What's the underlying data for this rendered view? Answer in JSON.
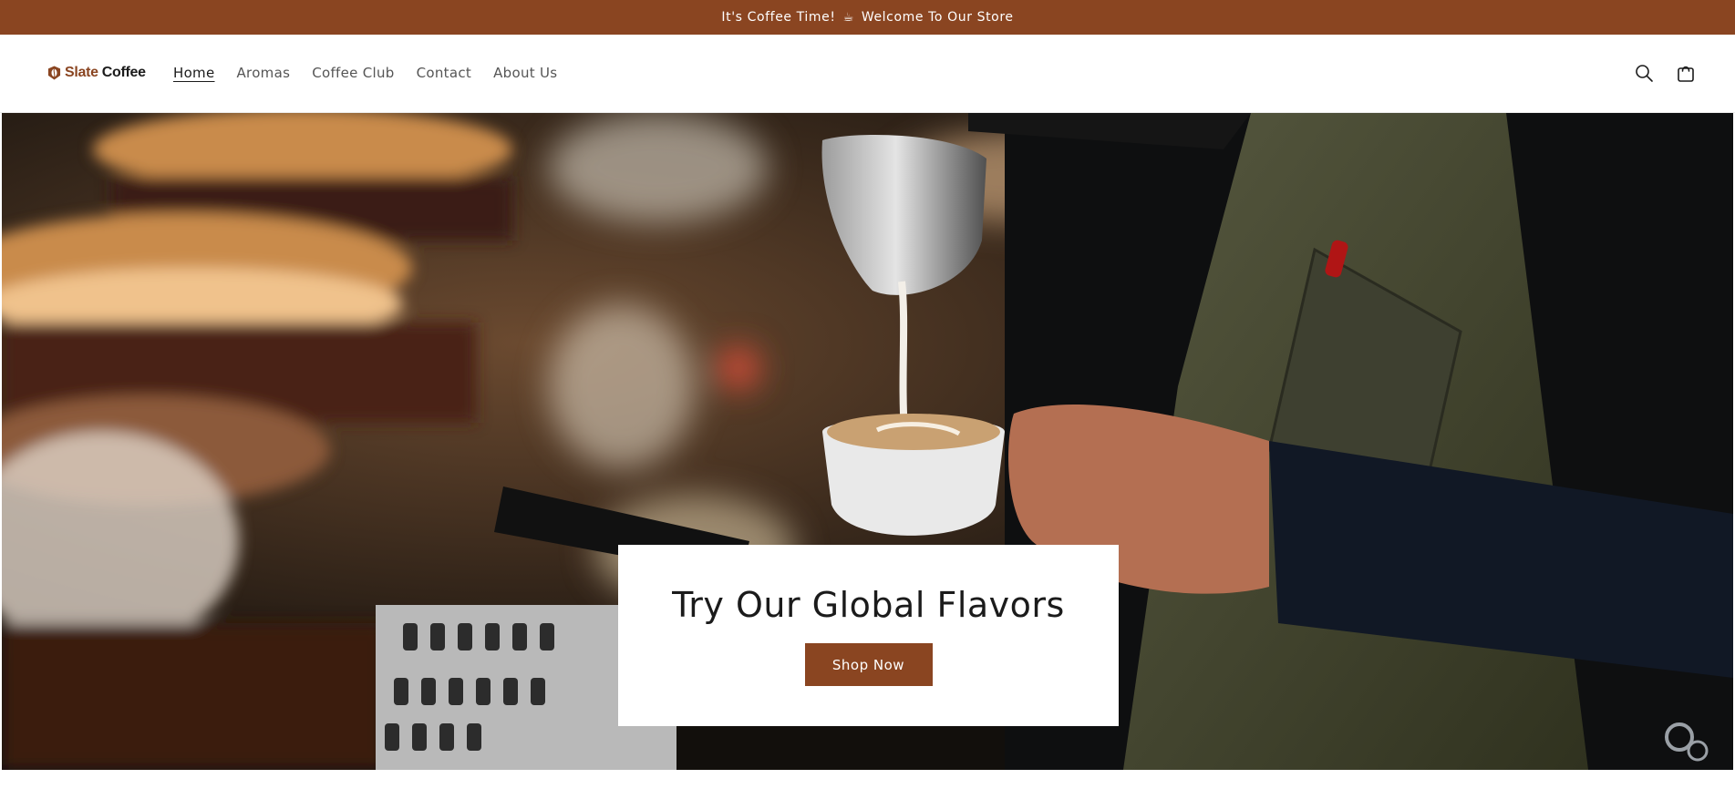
{
  "announcement": {
    "text_before": "It's Coffee Time!",
    "icon": "coffee-cup-icon",
    "text_after": "Welcome To Our Store"
  },
  "header": {
    "logo": {
      "icon": "coffee-bean-shield-icon",
      "brand_first": "Slate",
      "brand_second": "Coffee"
    },
    "nav": [
      {
        "label": "Home",
        "active": true
      },
      {
        "label": "Aromas",
        "active": false
      },
      {
        "label": "Coffee Club",
        "active": false
      },
      {
        "label": "Contact",
        "active": false
      },
      {
        "label": "About Us",
        "active": false
      }
    ],
    "icons": [
      "search-icon",
      "cart-icon"
    ]
  },
  "hero": {
    "image": "barista-pouring-latte-art-photo",
    "title": "Try Our Global Flavors",
    "button_label": "Shop Now"
  },
  "colors": {
    "brand": "#8a4521",
    "text": "#1b1b1b",
    "nav_text": "#555555"
  }
}
